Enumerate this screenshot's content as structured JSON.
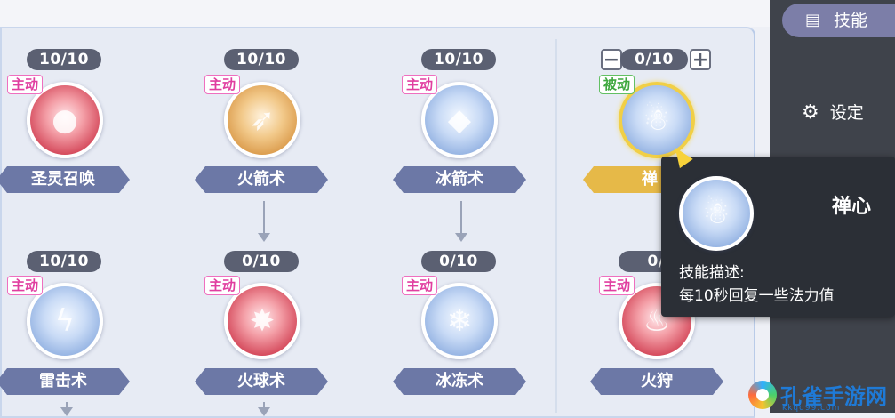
{
  "sidebar": {
    "skills_tab": "技能",
    "settings": "设定"
  },
  "skills": [
    {
      "name": "圣灵召唤",
      "level": "10/10",
      "type": "主动",
      "color": "red",
      "glyph": "●"
    },
    {
      "name": "火箭术",
      "level": "10/10",
      "type": "主动",
      "color": "orange",
      "glyph": "➶"
    },
    {
      "name": "冰箭术",
      "level": "10/10",
      "type": "主动",
      "color": "blue",
      "glyph": "◆"
    },
    {
      "name": "禅",
      "level": "0/10",
      "type": "被动",
      "color": "blue",
      "glyph": "☃"
    },
    {
      "name": "雷击术",
      "level": "10/10",
      "type": "主动",
      "color": "blue",
      "glyph": "ϟ"
    },
    {
      "name": "火球术",
      "level": "0/10",
      "type": "主动",
      "color": "red",
      "glyph": "✸"
    },
    {
      "name": "冰冻术",
      "level": "0/10",
      "type": "主动",
      "color": "blue",
      "glyph": "❄"
    },
    {
      "name": "火狩",
      "level": "0/",
      "type": "主动",
      "color": "red",
      "glyph": "♨"
    }
  ],
  "stepper": {
    "minus": "−",
    "plus": "+"
  },
  "tooltip": {
    "title": "禅心",
    "desc_label": "技能描述:",
    "desc": "每10秒回复一些法力值"
  },
  "watermark": {
    "text": "孔雀手游网",
    "url": "kkqq99.com"
  }
}
